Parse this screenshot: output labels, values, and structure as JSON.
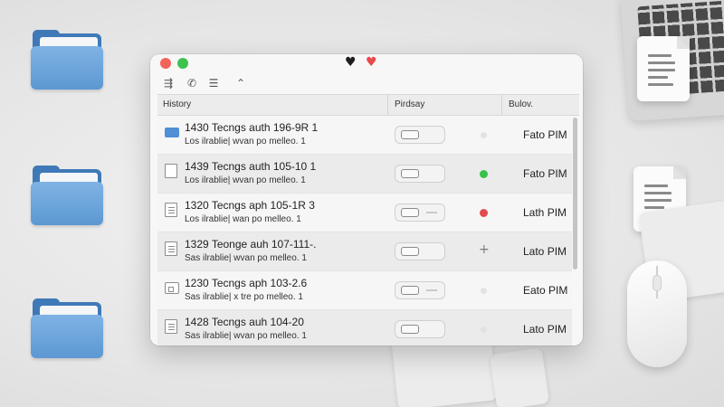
{
  "window": {
    "toolbar": {
      "icons": [
        "sliders-icon",
        "phone-icon",
        "text-icon",
        "chevron-up-icon"
      ],
      "glyphs": [
        "⇶",
        "✆",
        "☰",
        "⌃"
      ]
    },
    "favorite_glyph": "♥",
    "columns": {
      "name": "History",
      "toggle": "Pirdsay",
      "time": "Bulov."
    },
    "rows": [
      {
        "icon": "folder-icon",
        "title": "1430 Tecngs auth 196-9R 1",
        "subtitle": "Los ilrablie| wvan po melleo. 1",
        "status": "faint",
        "time": "Fato PIM"
      },
      {
        "icon": "blank-document-icon",
        "title": "1439 Tecngs auth 105-10 1",
        "subtitle": "Los ilrablie| wvan po melleo. 1",
        "status": "green",
        "time": "Fato PIM"
      },
      {
        "icon": "text-document-icon",
        "title": "1320 Tecngs aph 105-1R 3",
        "subtitle": "Los ilrablie| wan po melleo. 1",
        "status": "red",
        "time": "Lath PIM"
      },
      {
        "icon": "text-document-icon",
        "title": "1329 Teonge auh 107-111-.",
        "subtitle": "Sas ilrablie| wvan po melleo. 1",
        "status": "plus",
        "status_glyph": "+",
        "time": "Lato PIM"
      },
      {
        "icon": "image-icon",
        "title": "1230 Tecngs aph 103-2.6",
        "subtitle": "Sas ilrablie| x tre po melleo. 1",
        "status": "faint",
        "time": "Eato PIM"
      },
      {
        "icon": "text-document-icon",
        "title": "1428 Tecngs auh 104-20",
        "subtitle": "Sas ilrablie| wvan po melleo. 1",
        "status": "faint",
        "time": "Lato PIM"
      }
    ]
  },
  "desktop": {
    "items": [
      "folder-icon",
      "folder-icon",
      "folder-icon",
      "document-icon",
      "document-icon",
      "laptop",
      "mouse"
    ]
  }
}
